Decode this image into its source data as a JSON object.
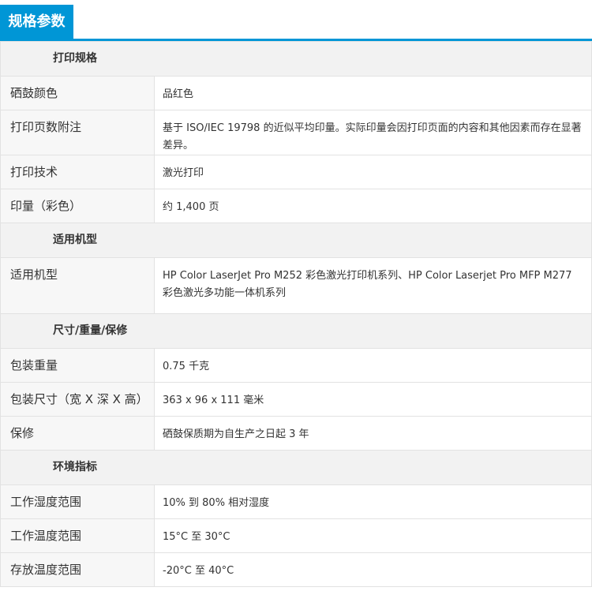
{
  "header": {
    "title": "规格参数"
  },
  "sections": {
    "print": {
      "heading": "打印规格",
      "rows": [
        {
          "label": "硒鼓颜色",
          "value": "品红色"
        },
        {
          "label": "打印页数附注",
          "value": "基于 ISO/IEC 19798 的近似平均印量。实际印量会因打印页面的内容和其他因素而存在显著差异。"
        },
        {
          "label": "打印技术",
          "value": "激光打印"
        },
        {
          "label": "印量（彩色）",
          "value": "约 1,400 页"
        }
      ]
    },
    "compat": {
      "heading": "适用机型",
      "rows": [
        {
          "label": "适用机型",
          "value": "HP Color LaserJet Pro M252 彩色激光打印机系列、HP Color Laserjet Pro MFP M277 彩色激光多功能一体机系列"
        }
      ]
    },
    "dims": {
      "heading": "尺寸/重量/保修",
      "rows": [
        {
          "label": "包装重量",
          "value": "0.75 千克"
        },
        {
          "label": "包装尺寸（宽 X 深 X 高）",
          "value": "363 x 96 x 111 毫米"
        },
        {
          "label": "保修",
          "value": "硒鼓保质期为自生产之日起 3 年"
        }
      ]
    },
    "env": {
      "heading": "环境指标",
      "rows": [
        {
          "label": "工作湿度范围",
          "value": "10% 到 80% 相对湿度"
        },
        {
          "label": "工作温度范围",
          "value": "15°C 至 30°C"
        },
        {
          "label": "存放温度范围",
          "value": "-20°C 至 40°C"
        }
      ]
    }
  },
  "colors": {
    "accent": "#0096d6",
    "section_bg": "#f2f2f2",
    "label_bg": "#f7f7f7",
    "border": "#e2e2e2"
  }
}
